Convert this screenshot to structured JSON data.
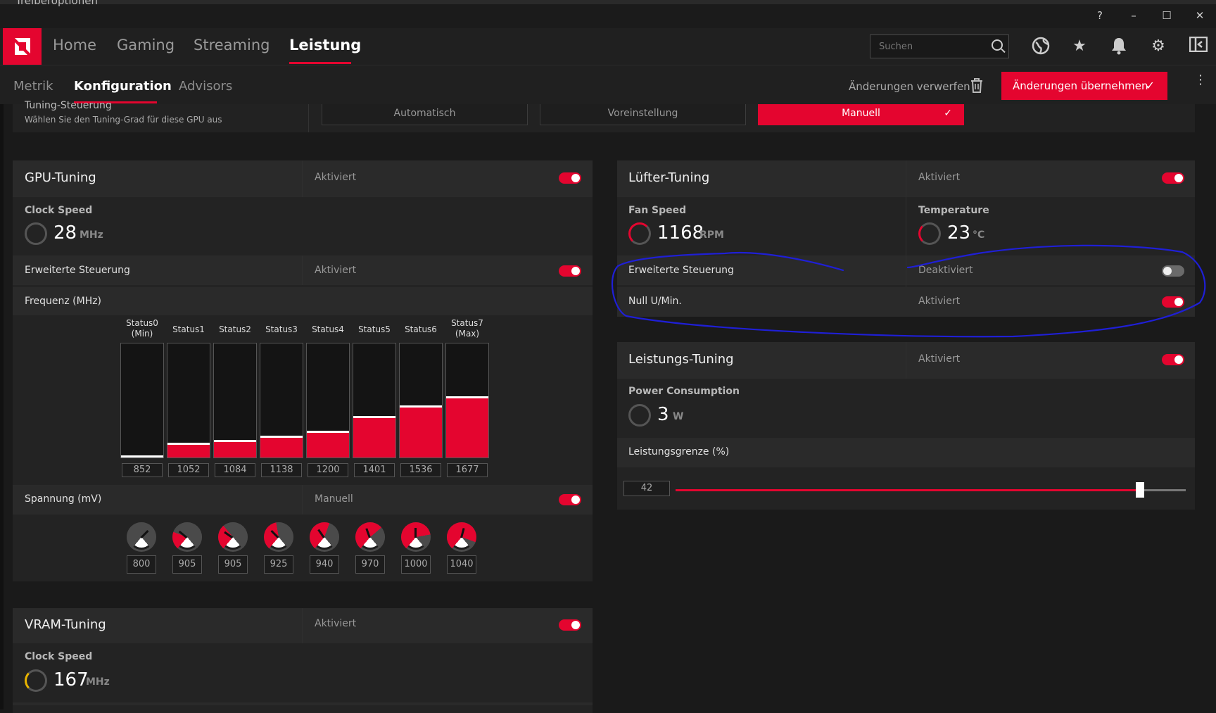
{
  "titlebar": {
    "cut_text": "Treiberoptionen"
  },
  "nav": {
    "tabs": [
      {
        "label": "Home"
      },
      {
        "label": "Gaming"
      },
      {
        "label": "Streaming"
      },
      {
        "label": "Leistung"
      }
    ],
    "active_tab": "Leistung",
    "search_placeholder": "Suchen",
    "icons": [
      "help-icon",
      "minimize-icon",
      "maximize-icon",
      "close-icon",
      "globe-icon",
      "star-icon",
      "bell-icon",
      "gear-icon",
      "sidebar-icon"
    ]
  },
  "subnav": {
    "tabs": [
      {
        "label": "Metrik"
      },
      {
        "label": "Konfiguration"
      },
      {
        "label": "Advisors"
      }
    ],
    "active_tab": "Konfiguration",
    "discard_label": "Änderungen verwerfen",
    "apply_label": "Änderungen übernehmen"
  },
  "tuning_control": {
    "title": "Tuning-Steuerung",
    "description": "Wählen Sie den Tuning-Grad für diese GPU aus",
    "modes": [
      "Automatisch",
      "Voreinstellung",
      "Manuell"
    ],
    "selected": "Manuell"
  },
  "gpu_tuning": {
    "title": "GPU-Tuning",
    "state": "Aktiviert",
    "clock_label": "Clock Speed",
    "clock_value": "28",
    "clock_unit": "MHz",
    "advanced_label": "Erweiterte Steuerung",
    "advanced_state": "Aktiviert",
    "freq_label": "Frequenz (MHz)",
    "states": [
      {
        "label": "Status0 (Min)",
        "value": "852",
        "level": 0.01
      },
      {
        "label": "Status1",
        "value": "1052",
        "level": 0.13
      },
      {
        "label": "Status2",
        "value": "1084",
        "level": 0.15
      },
      {
        "label": "Status3",
        "value": "1138",
        "level": 0.19
      },
      {
        "label": "Status4",
        "value": "1200",
        "level": 0.23
      },
      {
        "label": "Status5",
        "value": "1401",
        "level": 0.36
      },
      {
        "label": "Status6",
        "value": "1536",
        "level": 0.45
      },
      {
        "label": "Status7 (Max)",
        "value": "1677",
        "level": 0.53
      }
    ],
    "voltage_label": "Spannung (mV)",
    "voltage_state": "Manuell",
    "voltages": [
      "800",
      "905",
      "905",
      "925",
      "940",
      "970",
      "1000",
      "1040"
    ]
  },
  "vram_tuning": {
    "title": "VRAM-Tuning",
    "state": "Aktiviert",
    "clock_label": "Clock Speed",
    "clock_value": "167",
    "clock_unit": "MHz"
  },
  "fan_tuning": {
    "title": "Lüfter-Tuning",
    "state": "Aktiviert",
    "fan_label": "Fan Speed",
    "fan_value": "1168",
    "fan_unit": "RPM",
    "temp_label": "Temperature",
    "temp_value": "23",
    "temp_unit": "°C",
    "advanced_label": "Erweiterte Steuerung",
    "advanced_state": "Deaktiviert",
    "zero_rpm_label": "Null U/Min.",
    "zero_rpm_state": "Aktiviert"
  },
  "power_tuning": {
    "title": "Leistungs-Tuning",
    "state": "Aktiviert",
    "power_label": "Power Consumption",
    "power_value": "3",
    "power_unit": "W",
    "limit_label": "Leistungsgrenze (%)",
    "limit_value": "42",
    "limit_fraction": 0.91
  },
  "colors": {
    "accent": "#e4052f",
    "panel": "#232323",
    "background": "#1a1a1a",
    "annotation": "#1f1fd6"
  }
}
